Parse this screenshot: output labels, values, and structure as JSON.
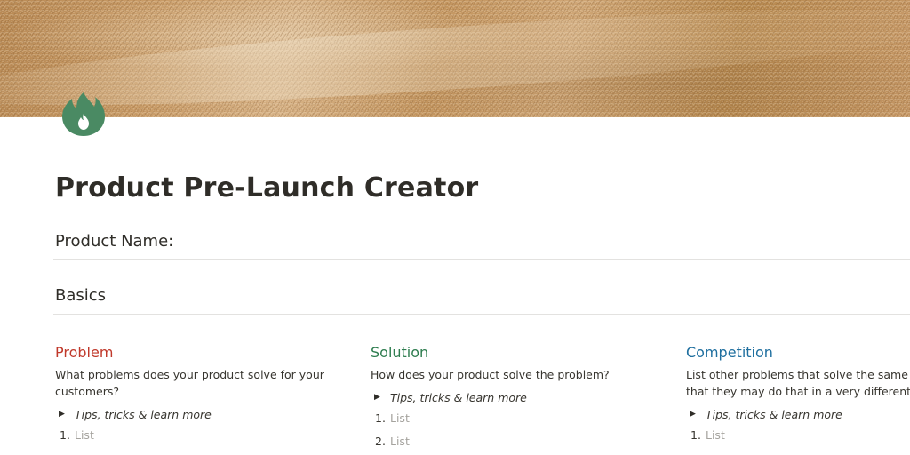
{
  "page": {
    "title": "Product Pre-Launch Creator",
    "icon": "flame-icon",
    "accent_color": "#4a8a63"
  },
  "sections": {
    "product_name": "Product Name:",
    "basics": "Basics"
  },
  "columns": [
    {
      "heading": "Problem",
      "heading_color": "#c0392b",
      "description_lines": [
        "What problems does your product solve for your",
        "customers?"
      ],
      "toggle": "Tips, tricks & learn more",
      "list": [
        {
          "num": "1.",
          "text": "List"
        }
      ]
    },
    {
      "heading": "Solution",
      "heading_color": "#2e7d4f",
      "description_lines": [
        "How does your product solve the problem?"
      ],
      "toggle": "Tips, tricks & learn more",
      "list": [
        {
          "num": "1.",
          "text": "List"
        },
        {
          "num": "2.",
          "text": "List"
        }
      ]
    },
    {
      "heading": "Competition",
      "heading_color": "#1f6f9f",
      "description_lines": [
        "List other problems that solve the same prob",
        "that they may do that in a very different fash"
      ],
      "toggle": "Tips, tricks & learn more",
      "list": [
        {
          "num": "1.",
          "text": "List"
        }
      ]
    }
  ]
}
